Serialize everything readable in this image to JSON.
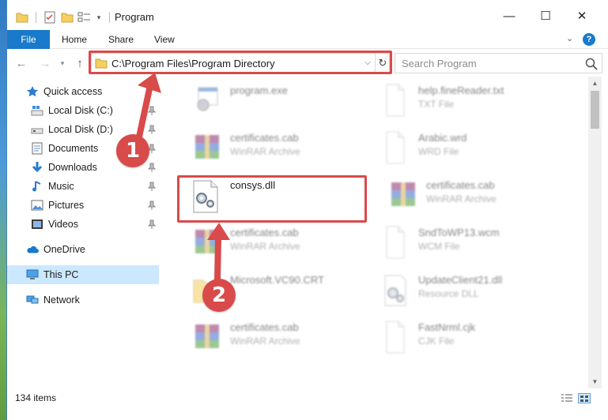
{
  "window": {
    "title": "Program",
    "minimize_glyph": "—",
    "maximize_glyph": "☐",
    "close_glyph": "✕"
  },
  "ribbon": {
    "tabs": [
      "File",
      "Home",
      "Share",
      "View"
    ],
    "help_glyph": "?",
    "collapse_glyph": "⌄"
  },
  "nav": {
    "back_glyph": "←",
    "forward_glyph": "→",
    "recent_glyph": "▾",
    "up_glyph": "↑",
    "address": "C:\\Program Files\\Program Directory",
    "address_dropdown_glyph": "⌵",
    "refresh_glyph": "↻",
    "search_placeholder": "Search Program"
  },
  "sidebar": {
    "items": [
      {
        "label": "Quick access",
        "icon": "star-icon"
      },
      {
        "label": "Local Disk (C:)",
        "icon": "drive-icon",
        "pinned": true
      },
      {
        "label": "Local Disk (D:)",
        "icon": "drive-icon",
        "pinned": true
      },
      {
        "label": "Documents",
        "icon": "documents-icon",
        "pinned": true
      },
      {
        "label": "Downloads",
        "icon": "downloads-icon",
        "pinned": true
      },
      {
        "label": "Music",
        "icon": "music-icon",
        "pinned": true
      },
      {
        "label": "Pictures",
        "icon": "pictures-icon",
        "pinned": true
      },
      {
        "label": "Videos",
        "icon": "videos-icon",
        "pinned": true
      },
      {
        "label": "OneDrive",
        "icon": "cloud-icon"
      },
      {
        "label": "This PC",
        "icon": "computer-icon",
        "selected": true
      },
      {
        "label": "Network",
        "icon": "network-icon"
      }
    ]
  },
  "files": [
    {
      "name": "program.exe",
      "type": "",
      "icon": "exe-icon",
      "blurred": true
    },
    {
      "name": "help.fineReader.txt",
      "type": "TXT File",
      "icon": "document-icon",
      "blurred": true
    },
    {
      "name": "certificates.cab",
      "type": "WinRAR Archive",
      "icon": "winrar-icon",
      "blurred": true
    },
    {
      "name": "Arabic.wrd",
      "type": "WRD File",
      "icon": "document-icon",
      "blurred": true
    },
    {
      "name": "consys.dll",
      "type": "",
      "icon": "dll-gear-icon",
      "blurred": false
    },
    {
      "name": "certificates.cab",
      "type": "WinRAR Archive",
      "icon": "winrar-icon",
      "blurred": true
    },
    {
      "name": "certificates.cab",
      "type": "WinRAR Archive",
      "icon": "winrar-icon",
      "blurred": true
    },
    {
      "name": "SndToWP13.wcm",
      "type": "WCM File",
      "icon": "document-icon",
      "blurred": true
    },
    {
      "name": "Microsoft.VC90.CRT",
      "type": "",
      "icon": "folder-icon",
      "blurred": true
    },
    {
      "name": "UpdateClient21.dll",
      "type": "Resource DLL",
      "icon": "dll-gear-icon",
      "blurred": true
    },
    {
      "name": "certificates.cab",
      "type": "WinRAR Archive",
      "icon": "winrar-icon",
      "blurred": true
    },
    {
      "name": "FastNrml.cjk",
      "type": "CJK File",
      "icon": "document-icon",
      "blurred": true
    }
  ],
  "status": {
    "item_count": "134 items"
  },
  "annotations": {
    "step1": "1",
    "step2": "2",
    "color": "#d94a4a"
  },
  "colors": {
    "accent": "#1979ca",
    "selection": "#cce8ff",
    "highlight": "#d94a4a"
  }
}
